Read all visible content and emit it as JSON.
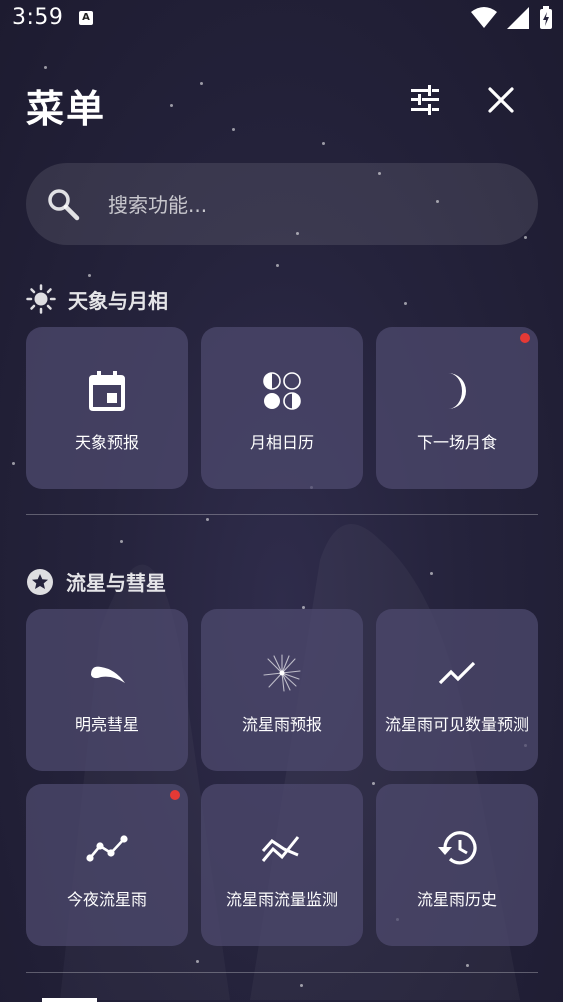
{
  "status_bar": {
    "time": "3:59",
    "notification_glyph": "A"
  },
  "header": {
    "title": "菜单"
  },
  "search": {
    "placeholder": "搜索功能..."
  },
  "sections": [
    {
      "title": "天象与月相",
      "icon": "sun-icon",
      "items": [
        {
          "label": "天象预报",
          "icon": "calendar-icon",
          "badge": false
        },
        {
          "label": "月相日历",
          "icon": "moon-phases-icon",
          "badge": false
        },
        {
          "label": "下一场月食",
          "icon": "crescent-moon-icon",
          "badge": true
        }
      ]
    },
    {
      "title": "流星与彗星",
      "icon": "star-circle-icon",
      "items": [
        {
          "label": "明亮彗星",
          "icon": "comet-icon",
          "badge": false
        },
        {
          "label": "流星雨预报",
          "icon": "meteor-burst-icon",
          "badge": false
        },
        {
          "label": "流星雨可见数量预测",
          "icon": "trending-up-icon",
          "badge": false
        },
        {
          "label": "今夜流星雨",
          "icon": "timeline-icon",
          "badge": true
        },
        {
          "label": "流星雨流量监测",
          "icon": "multiline-chart-icon",
          "badge": false
        },
        {
          "label": "流星雨历史",
          "icon": "history-icon",
          "badge": false
        }
      ]
    }
  ],
  "colors": {
    "badge": "#e53935",
    "card": "#4e496e",
    "background": "#25233c"
  }
}
